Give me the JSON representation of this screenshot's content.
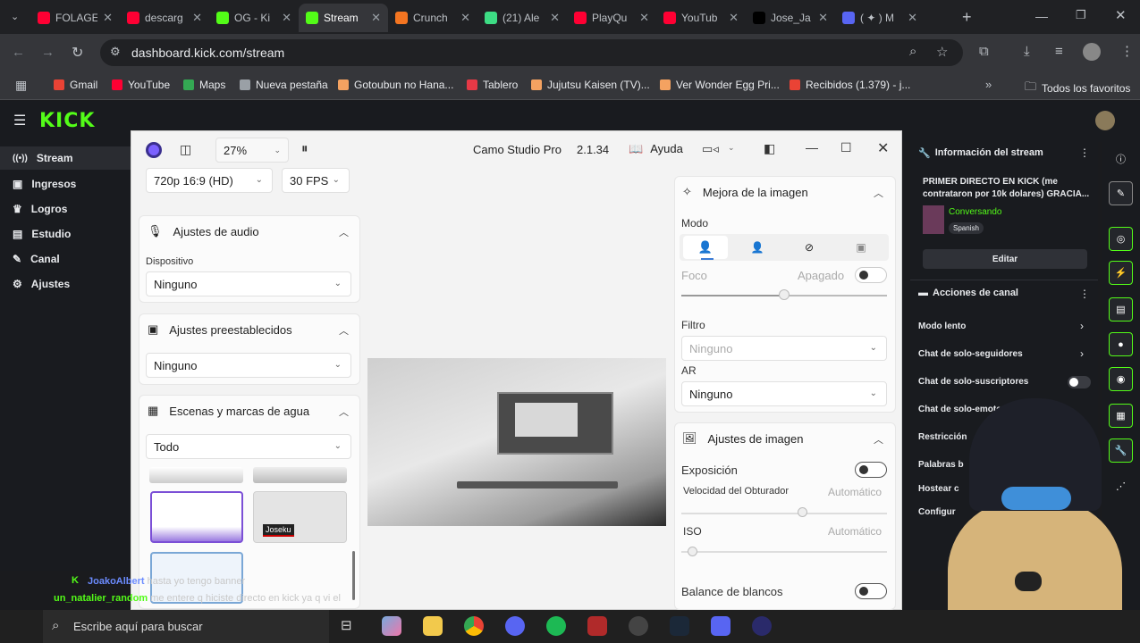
{
  "browser": {
    "tabs": [
      {
        "title": "FOLAGE",
        "color": "#ff0033",
        "active": false
      },
      {
        "title": "descarg",
        "color": "#ff0033",
        "active": false
      },
      {
        "title": "OG - Ki",
        "color": "#53fc18",
        "active": false
      },
      {
        "title": "Stream",
        "color": "#53fc18",
        "active": true
      },
      {
        "title": "Crunch",
        "color": "#f47521",
        "active": false
      },
      {
        "title": "(21) Ale",
        "color": "#3ddc84",
        "active": false
      },
      {
        "title": "PlayQu",
        "color": "#ff0033",
        "active": false
      },
      {
        "title": "YouTub",
        "color": "#ff0033",
        "active": false
      },
      {
        "title": "Jose_Ja",
        "color": "#000000",
        "active": false
      },
      {
        "title": "( ✦ ) M",
        "color": "#5865f2",
        "active": false
      }
    ],
    "url": "dashboard.kick.com/stream",
    "bookmarks": [
      {
        "label": "Gmail",
        "color": "#ea4335"
      },
      {
        "label": "YouTube",
        "color": "#ff0033"
      },
      {
        "label": "Maps",
        "color": "#34a853"
      },
      {
        "label": "Nueva pestaña",
        "color": "#9aa0a6"
      },
      {
        "label": "Gotoubun no Hana...",
        "color": "#f4a261"
      },
      {
        "label": "Tablero",
        "color": "#e63946"
      },
      {
        "label": "Jujutsu Kaisen (TV)...",
        "color": "#f4a261"
      },
      {
        "label": "Ver Wonder Egg Pri...",
        "color": "#f4a261"
      },
      {
        "label": "Recibidos (1.379) - j...",
        "color": "#ea4335"
      }
    ],
    "all_bookmarks": "Todos los favoritos"
  },
  "kick": {
    "logo": "KICK",
    "nav": [
      {
        "label": "Stream",
        "icon": "wifi-icon",
        "active": true
      },
      {
        "label": "Ingresos",
        "icon": "card-icon",
        "active": false
      },
      {
        "label": "Logros",
        "icon": "trophy-icon",
        "active": false
      },
      {
        "label": "Estudio",
        "icon": "studio-icon",
        "active": false
      },
      {
        "label": "Canal",
        "icon": "channel-icon",
        "active": false
      },
      {
        "label": "Ajustes",
        "icon": "gear-icon",
        "active": false
      }
    ],
    "stream_info": {
      "header": "Información del stream",
      "title": "PRIMER DIRECTO EN KICK (me contrataron por 10k dolares) GRACIA...",
      "category": "Conversando",
      "language": "Spanish",
      "edit": "Editar"
    },
    "channel_actions": {
      "header": "Acciones de canal",
      "items": [
        "Modo lento",
        "Chat de solo-seguidores",
        "Chat de solo-suscriptores",
        "Chat de solo-emotes",
        "Restricción",
        "Palabras b",
        "Hostear c",
        "Configur"
      ]
    }
  },
  "camo": {
    "zoom": "27%",
    "app_name": "Camo Studio Pro",
    "version": "2.1.34",
    "help": "Ayuda",
    "resolution": "720p 16:9 (HD)",
    "fps": "30 FPS",
    "audio": {
      "title": "Ajustes de audio",
      "device_label": "Dispositivo",
      "device_value": "Ninguno"
    },
    "presets": {
      "title": "Ajustes preestablecidos",
      "value": "Ninguno"
    },
    "scenes": {
      "title": "Escenas y marcas de agua",
      "filter": "Todo",
      "watermark_text": "Joseku"
    },
    "enhance": {
      "title": "Mejora de la imagen",
      "mode_label": "Modo",
      "focus_label": "Foco",
      "focus_value": "Apagado",
      "filter_label": "Filtro",
      "filter_value": "Ninguno",
      "ar_label": "AR",
      "ar_value": "Ninguno"
    },
    "image": {
      "title": "Ajustes de imagen",
      "exposure": "Exposición",
      "shutter": "Velocidad del Obturador",
      "shutter_value": "Automático",
      "iso": "ISO",
      "iso_value": "Automático",
      "wb": "Balance de blancos"
    }
  },
  "chat_overlay": [
    {
      "user": "JoakoAlbert",
      "text": "hasta yo tengo banner",
      "color": "#6c8cff"
    },
    {
      "user": "un_natalier_random",
      "text": "me entere q hiciste directo en kick ya q vi el",
      "color": "#53fc18"
    }
  ],
  "taskbar": {
    "search_placeholder": "Escribe aquí para buscar"
  }
}
